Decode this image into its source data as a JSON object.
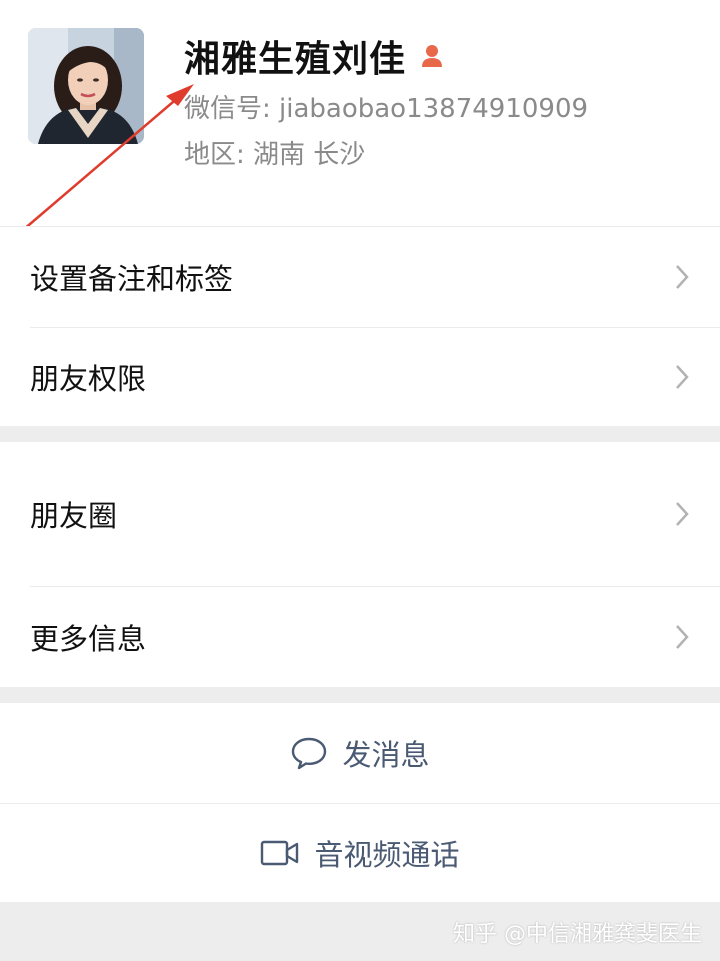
{
  "profile": {
    "name": "湘雅生殖刘佳",
    "wechat_id": "微信号: jiabaobao13874910909",
    "region": "地区: 湖南  长沙",
    "gender_icon": "female-person-icon",
    "accent_color": "#e8684a"
  },
  "menu": {
    "remark_tags": "设置备注和标签",
    "friend_permissions": "朋友权限",
    "moments": "朋友圈",
    "more_info": "更多信息"
  },
  "actions": {
    "send_message": "发消息",
    "video_call": "音视频通话"
  },
  "watermark": "知乎 @中信湘雅龚斐医生",
  "colors": {
    "action_text": "#4a5a73",
    "annotation_arrow": "#e03c2d",
    "separator": "#ededed"
  }
}
